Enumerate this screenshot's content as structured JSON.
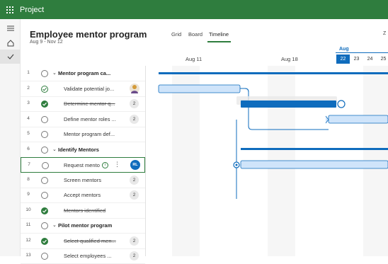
{
  "app": {
    "name": "Project"
  },
  "rail": {
    "menu_icon": "hamburger-icon",
    "home_icon": "home-icon",
    "check_icon": "checkmark-icon"
  },
  "header": {
    "title": "Employee mentor program",
    "dates": "Aug 9 - Nov 12",
    "tabs": [
      {
        "label": "Grid"
      },
      {
        "label": "Board"
      },
      {
        "label": "Timeline"
      }
    ],
    "zoom_label": "Z"
  },
  "timeline": {
    "weeks": [
      {
        "label": "Aug 11"
      },
      {
        "label": "Aug 18"
      }
    ],
    "month": "Aug",
    "days": [
      "22",
      "23",
      "24",
      "25"
    ]
  },
  "tasks": [
    {
      "num": "1",
      "name": "Mentor program ca...",
      "summary": true,
      "status": "open"
    },
    {
      "num": "2",
      "name": "Validate potential jo...",
      "status": "half",
      "assignee": "photo"
    },
    {
      "num": "3",
      "name": "Determine mentor q...",
      "status": "done",
      "count": "2"
    },
    {
      "num": "4",
      "name": "Define mentor roles ...",
      "status": "open",
      "count": "2"
    },
    {
      "num": "5",
      "name": "Mentor program def...",
      "status": "open"
    },
    {
      "num": "6",
      "name": "Identify Mentors",
      "summary": true,
      "status": "open"
    },
    {
      "num": "7",
      "name": "Request mento",
      "status": "open",
      "selected": true,
      "assignee_initials": "RL"
    },
    {
      "num": "8",
      "name": "Screen mentors",
      "status": "open",
      "count": "2"
    },
    {
      "num": "9",
      "name": "Accept mentors",
      "status": "open",
      "count": "2"
    },
    {
      "num": "10",
      "name": "Mentors identified",
      "status": "done"
    },
    {
      "num": "11",
      "name": "Pilot mentor program",
      "summary": true,
      "status": "open"
    },
    {
      "num": "12",
      "name": "Select qualified men...",
      "status": "done",
      "count": "2"
    },
    {
      "num": "13",
      "name": "Select employees ...",
      "status": "open",
      "count": "2"
    }
  ],
  "colors": {
    "brand": "#2f7d3e",
    "accent": "#0f6cbd",
    "bar_light": "#cfe4fa"
  }
}
